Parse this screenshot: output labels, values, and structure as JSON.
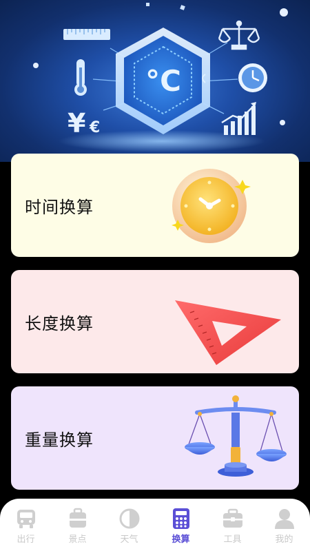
{
  "hero": {
    "temperature_symbol": "°C",
    "currency_symbol": "¥€"
  },
  "cards": [
    {
      "label": "时间换算",
      "icon": "clock-icon"
    },
    {
      "label": "长度换算",
      "icon": "ruler-triangle-icon"
    },
    {
      "label": "重量换算",
      "icon": "balance-scale-icon"
    }
  ],
  "nav": {
    "items": [
      {
        "label": "出行",
        "icon": "bus-icon"
      },
      {
        "label": "景点",
        "icon": "luggage-icon"
      },
      {
        "label": "天气",
        "icon": "half-circle-icon"
      },
      {
        "label": "换算",
        "icon": "calculator-icon",
        "active": true
      },
      {
        "label": "工具",
        "icon": "toolbox-icon"
      },
      {
        "label": "我的",
        "icon": "user-icon"
      }
    ]
  },
  "colors": {
    "active": "#5b4fd6",
    "inactive": "#c9c9c9",
    "card_time_bg": "#fefde6",
    "card_length_bg": "#fde9ea",
    "card_weight_bg": "#efe4fc"
  }
}
